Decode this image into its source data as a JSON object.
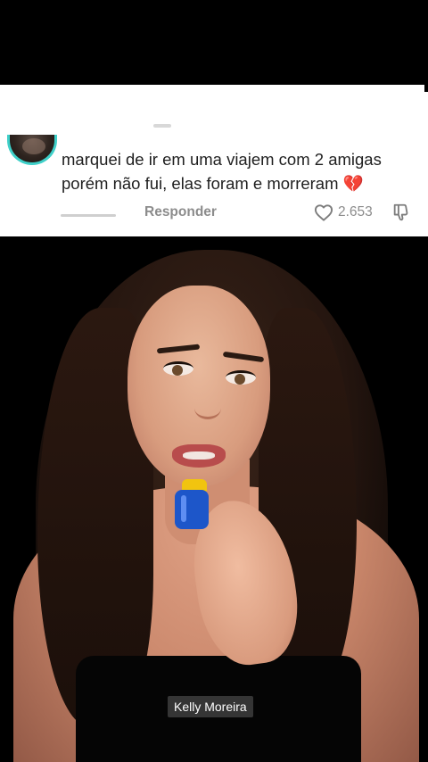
{
  "comment": {
    "lines": [
      "marquei de ir em uma viajem com 2 amigas",
      "porém não fui, elas foram e morreram"
    ],
    "emoji": "💔",
    "reply_label": "Responder",
    "like_count": "2.653"
  },
  "icons": {
    "like": "heart-outline-icon",
    "dislike": "thumbs-down-icon",
    "avatar": "user-avatar"
  },
  "colors": {
    "avatar_ring": "#3fd0c9",
    "meta_text": "#8c8c8c",
    "card_bg": "#ffffff",
    "page_bg": "#000000"
  },
  "video": {
    "caption": "Kelly Moreira"
  }
}
